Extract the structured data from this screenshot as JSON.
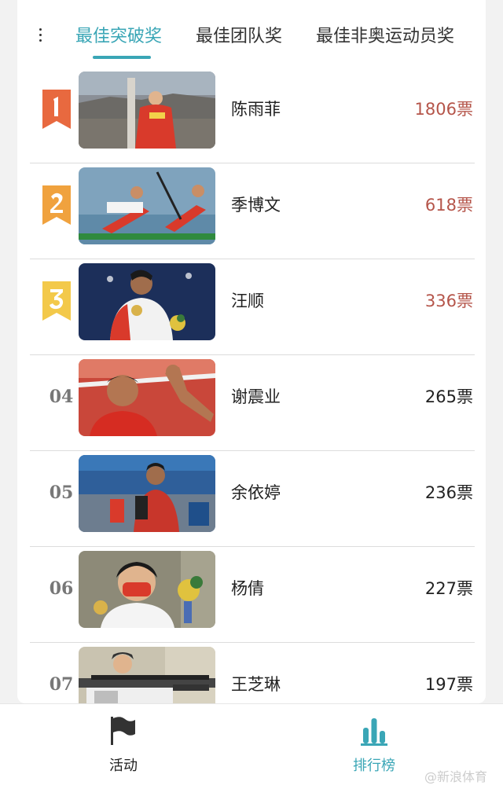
{
  "tabs": [
    {
      "label": "最佳突破奖",
      "active": true
    },
    {
      "label": "最佳团队奖",
      "active": false
    },
    {
      "label": "最佳非奥运动员奖",
      "active": false
    }
  ],
  "ranking": [
    {
      "rank": "1",
      "name": "陈雨菲",
      "votes": "1806票",
      "badge_color": "#e8693f"
    },
    {
      "rank": "2",
      "name": "季博文",
      "votes": "618票",
      "badge_color": "#f0a23e"
    },
    {
      "rank": "3",
      "name": "汪顺",
      "votes": "336票",
      "badge_color": "#f3c94a"
    },
    {
      "rank": "04",
      "name": "谢震业",
      "votes": "265票"
    },
    {
      "rank": "05",
      "name": "余依婷",
      "votes": "236票"
    },
    {
      "rank": "06",
      "name": "杨倩",
      "votes": "227票"
    },
    {
      "rank": "07",
      "name": "王芝琳",
      "votes": "197票"
    }
  ],
  "bottom_nav": [
    {
      "label": "活动",
      "icon": "flag-icon",
      "active": false
    },
    {
      "label": "排行榜",
      "icon": "bar-chart-icon",
      "active": true
    }
  ],
  "watermark": "@新浪体育",
  "colors": {
    "accent": "#3aa6b6",
    "top_votes": "#b5554a"
  }
}
